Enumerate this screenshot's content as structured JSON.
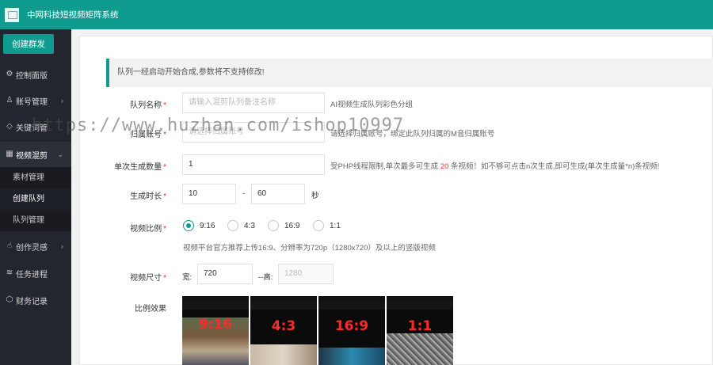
{
  "header": {
    "title": "中网科技短视频矩阵系统",
    "logo": "broken-image-icon"
  },
  "sidebar": {
    "create_button": "创建群发",
    "items": [
      {
        "label": "控制面版",
        "icon": "dashboard-icon"
      },
      {
        "label": "账号管理",
        "icon": "user-icon"
      },
      {
        "label": "关键词管",
        "icon": "diamond-icon"
      },
      {
        "label": "视频混剪",
        "icon": "grid-icon"
      },
      {
        "label": "创作灵感",
        "icon": "hand-icon"
      },
      {
        "label": "任务进程",
        "icon": "layers-icon"
      },
      {
        "label": "财务记录",
        "icon": "cube-icon"
      }
    ],
    "submenu": [
      "素材管理",
      "创建队列",
      "队列管理"
    ]
  },
  "notice": "队列一经启动开始合成,参数将不支持修改!",
  "form": {
    "queue_name": {
      "label": "队列名称",
      "placeholder": "请输入混剪队列备注名称",
      "hint": "AI视频生成队列彩色分组"
    },
    "account": {
      "label": "归属账号",
      "placeholder": "请选择归属账号",
      "hint": "请选择归属账号，绑定此队列归属的M音归属账号"
    },
    "batch_count": {
      "label": "单次生成数量",
      "value": "1",
      "hint_pre": "受PHP线程限制,单次最多可生成",
      "hint_num": "20",
      "hint_post": "条视频！如不够可点击n次生成,即可生成(单次生成量*n)条视频!"
    },
    "duration": {
      "label": "生成时长",
      "min": "10",
      "sep": "-",
      "max": "60",
      "unit": "秒"
    },
    "ratio": {
      "label": "视频比例",
      "options": [
        "9:16",
        "4:3",
        "16:9",
        "1:1"
      ],
      "selected": "9:16",
      "hint": "视频平台官方推荐上传16:9、分辨率为720p（1280x720）及以上的竖版视频"
    },
    "size": {
      "label": "视频尺寸",
      "width_label": "宽:",
      "width": "720",
      "height_label": "--高:",
      "height": "1280"
    },
    "preview": {
      "label": "比例效果",
      "thumbs": [
        "9:16",
        "4:3",
        "16:9",
        "1:1"
      ]
    }
  },
  "watermark": "https://www.huzhan.com/ishop10997",
  "colors": {
    "accent": "#0f9b8e",
    "sidebar": "#23262e",
    "required": "#e33333"
  }
}
